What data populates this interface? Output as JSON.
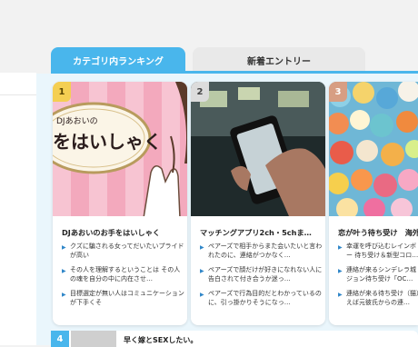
{
  "tabs": {
    "ranking": "カテゴリ内ランキング",
    "new": "新着エントリー"
  },
  "cards": [
    {
      "rank": "1",
      "image_text": [
        "DJあおいの",
        "をはいしゃく"
      ],
      "title": "DJあおいのお手をはいしゃく",
      "items": [
        "クズに騙される女ってだいたいプライドが高い",
        "その人を理解するということは その人の魂を自分の中に内在させ…",
        "目標選定が無い人はコミュニケーションが下手くそ"
      ]
    },
    {
      "rank": "2",
      "title": "マッチングアプリ2ch・5chま…",
      "items": [
        "ペアーズで相手からまた会いたいと言われたのに、連絡がつかなく…",
        "ペアーズで顔だけが好きになれない人に告白されて付き合うか迷っ…",
        "ペアーズで行為目的だとわかっているのに、引っ掛かりそうになっ…"
      ]
    },
    {
      "rank": "3",
      "title": "恋が叶う待ち受け　海外",
      "items": [
        "幸運を呼び込むレインボー 待ち受け＆新型コロ…",
        "連絡が来るシンデレラ城 ジョン待ち受け「OC…",
        "連絡が来る待ち受け（猫）えば元彼氏からの連…"
      ]
    }
  ],
  "row4": {
    "rank": "4",
    "title": "早く嫁とSEXしたい。"
  },
  "colors": {
    "accent": "#49b6ec",
    "rank1": "#f4cf52",
    "rank3": "#d79e83"
  }
}
